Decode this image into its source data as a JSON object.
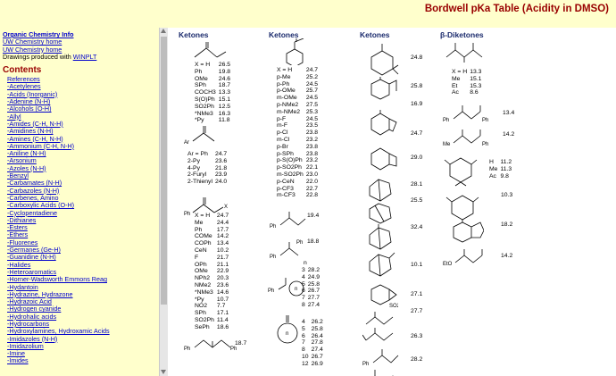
{
  "page_title": "Bordwell pKa Table (Acidity in DMSO)",
  "sidebar": {
    "links": [
      "Organic Chemistry Info",
      "UW Chemistry home",
      "UW Chemistry home",
      "Drawings produced with",
      "WINPLT"
    ],
    "contents_heading": "Contents",
    "items": [
      "References",
      "-Acetylenes",
      "-Acids (Inorganic)",
      "-Adenine (N-H)",
      "-Alcohols (O-H)",
      "-Allyl",
      "-Amides (C-H, N-H)",
      "-Amidines (N-H)",
      "-Amines (C-H, N-H)",
      "-Ammonium (C-H, N-H)",
      "-Aniline (N-H)",
      "-Arsonium",
      "-Azoles (N-H)",
      "-Benzyl",
      "-Carbamates (N-H)",
      "-Carbazoles (N-H)",
      "-Carbenes, Amino",
      "-Carboxylic Acids (O-H)",
      "-Cyclopentadiene",
      "-Dithianes",
      "-Esters",
      "-Ethers",
      "-Fluorenes",
      "-Germanes (Ge-H)",
      "-Guanidine (N-H)",
      "-Halides",
      "-Heteroaromatics",
      "-Horner-Wadsworth Emmons Reag",
      "-Hydantoin",
      "-Hydrazine, Hydrazone",
      "-Hydrazoic Acid",
      "-Hydrogen cyanide",
      "-Hydrohalic acids",
      "-Hydrocarbons",
      "-Hydroxylamines, Hydroxamic Acids",
      "-Imidazoles (N-H)",
      "-Imidazolium",
      "-Imine",
      "-Imides"
    ]
  },
  "columns": {
    "c1": "Ketones",
    "c2": "Ketones",
    "c3": "Ketones",
    "c4": "β-Diketones"
  },
  "col1": {
    "t1": [
      [
        "X = H",
        "26.5"
      ],
      [
        "Ph",
        "19.8"
      ],
      [
        "OMe",
        "24.6"
      ],
      [
        "SPh",
        "18.7"
      ],
      [
        "COCH3",
        "13.3"
      ],
      [
        "S(O)Ph",
        "15.1"
      ],
      [
        "SO2Ph",
        "12.5"
      ],
      [
        "*NMe3",
        "16.3"
      ],
      [
        "*Py",
        "11.8"
      ]
    ],
    "t2": [
      [
        "Ar = Ph",
        "24.7"
      ],
      [
        "2-Py",
        "23.6"
      ],
      [
        "4-Py",
        "21.8"
      ],
      [
        "2-Furyl",
        "23.9"
      ],
      [
        "2-Thienyl",
        "24.0"
      ]
    ],
    "t3": [
      [
        "X = H",
        "24.7"
      ],
      [
        "Me",
        "24.4"
      ],
      [
        "Ph",
        "17.7"
      ],
      [
        "COMe",
        "14.2"
      ],
      [
        "COPh",
        "13.4"
      ],
      [
        "CeN",
        "10.2"
      ],
      [
        "F",
        "21.7"
      ],
      [
        "OPh",
        "21.1"
      ],
      [
        "OMe",
        "22.9"
      ],
      [
        "NPh2",
        "20.3"
      ],
      [
        "NMe2",
        "23.6"
      ],
      [
        "*NMe3",
        "14.6"
      ],
      [
        "*Py",
        "10.7"
      ],
      [
        "NO2",
        "7.7"
      ],
      [
        "SPh",
        "17.1"
      ],
      [
        "SO2Ph",
        "11.4"
      ],
      [
        "SePh",
        "18.6"
      ]
    ],
    "t4": "18.7"
  },
  "col2": {
    "t1": [
      [
        "X = H",
        "24.7"
      ],
      [
        "p-Me",
        "25.2"
      ],
      [
        "p-Ph",
        "24.5"
      ],
      [
        "p-OMe",
        "25.7"
      ],
      [
        "m-OMe",
        "24.5"
      ],
      [
        "p-NMe2",
        "27.5"
      ],
      [
        "m-NMe2",
        "25.3"
      ],
      [
        "p-F",
        "24.5"
      ],
      [
        "m-F",
        "23.5"
      ],
      [
        "p-Cl",
        "23.8"
      ],
      [
        "m-Cl",
        "23.2"
      ],
      [
        "p-Br",
        "23.8"
      ],
      [
        "p-SPh",
        "23.8"
      ],
      [
        "p-S(O)Ph",
        "23.2"
      ],
      [
        "p-SO2Ph",
        "22.1"
      ],
      [
        "m-SO2Ph",
        "23.0"
      ],
      [
        "p-CeN",
        "22.0"
      ],
      [
        "p-CF3",
        "22.7"
      ],
      [
        "m-CF3",
        "22.8"
      ]
    ],
    "v1": "19.4",
    "v2": "18.8",
    "n_label": "n",
    "t2": [
      [
        "3",
        "28.2"
      ],
      [
        "4",
        "24.9"
      ],
      [
        "5",
        "25.8"
      ],
      [
        "6",
        "26.7"
      ],
      [
        "7",
        "27.7"
      ],
      [
        "8",
        "27.4"
      ]
    ],
    "t3": [
      [
        "4",
        "26.2"
      ],
      [
        "5",
        "25.8"
      ],
      [
        "6",
        "26.4"
      ],
      [
        "7",
        "27.8"
      ],
      [
        "8",
        "27.4"
      ],
      [
        "10",
        "26.7"
      ],
      [
        "12",
        "26.9"
      ]
    ],
    "n_ring": "n"
  },
  "col3": {
    "values": [
      "24.8",
      "25.8",
      "16.9",
      "24.7",
      "29.0",
      "28.1",
      "25.5",
      "32.4",
      "10.1",
      "27.1",
      "27.7",
      "26.3",
      "28.2"
    ],
    "ph": "Ph"
  },
  "col4": {
    "t1": [
      [
        "X = H",
        "13.3"
      ],
      [
        "Me",
        "15.1"
      ],
      [
        "Et",
        "15.3"
      ],
      [
        "Ac",
        "8.6"
      ]
    ],
    "v1": "13.4",
    "v2": "14.2",
    "t2": [
      [
        "H",
        "11.2"
      ],
      [
        "Me",
        "11.3"
      ],
      [
        "Ac",
        "9.8"
      ]
    ],
    "v3": "10.3",
    "v4": "18.2",
    "v5": "14.2",
    "eto": "EtO"
  }
}
